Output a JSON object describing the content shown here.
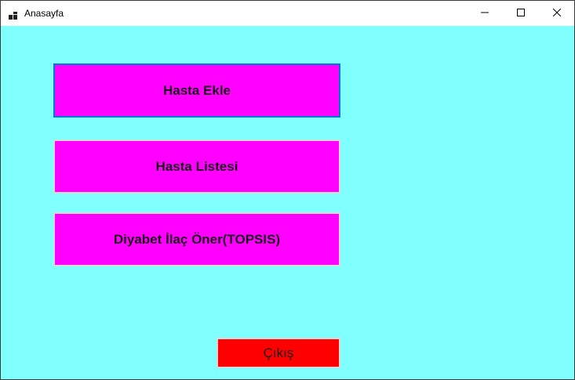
{
  "window": {
    "title": "Anasayfa",
    "background_color": "#80ffff",
    "controls": [
      "minimize-icon",
      "maximize-icon",
      "close-icon"
    ]
  },
  "buttons": {
    "add_patient": "Hasta Ekle",
    "patient_list": "Hasta Listesi",
    "topsis": "Diyabet İlaç Öner(TOPSIS)",
    "exit": "Çıkış"
  },
  "colors": {
    "menu_button": "#ff00ff",
    "exit_button": "#ff0000",
    "focus_border": "#0078d7"
  }
}
